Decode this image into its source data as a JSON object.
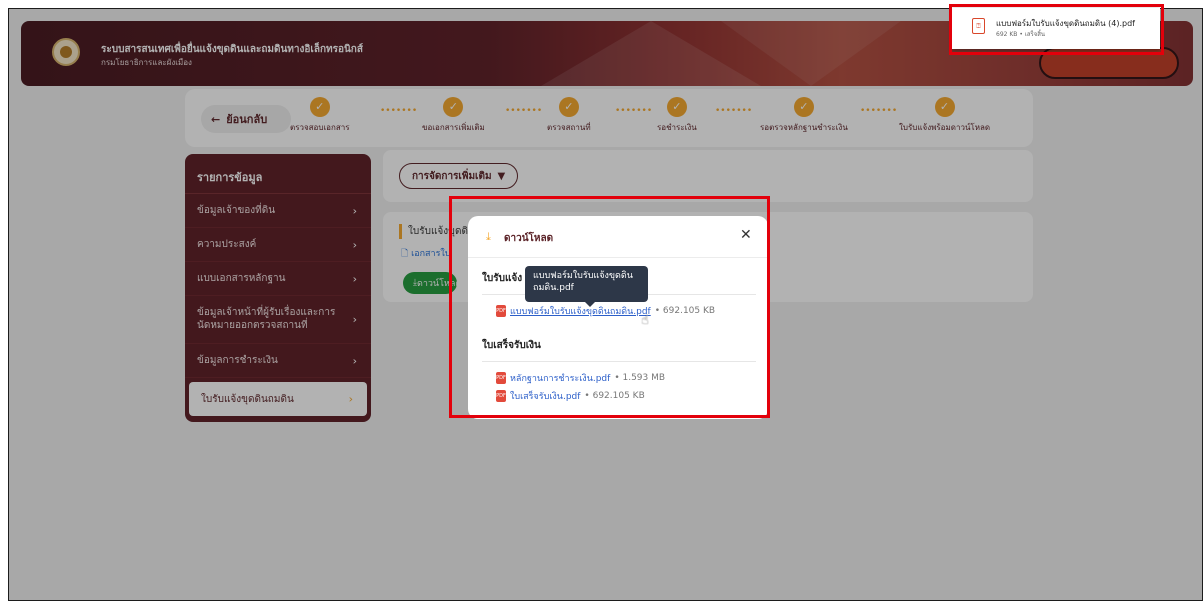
{
  "header": {
    "title": "ระบบสารสนเทศเพื่อยื่นแจ้งขุดดินและถมดินทางอิเล็กทรอนิกส์",
    "subtitle": "กรมโยธาธิการและผังเมือง"
  },
  "steps": {
    "back_label": "ย้อนกลับ",
    "items": [
      {
        "label": "ตรวจสอบเอกสาร"
      },
      {
        "label": "ขอเอกสารเพิ่มเติม"
      },
      {
        "label": "ตรวจสถานที่"
      },
      {
        "label": "รอชำระเงิน"
      },
      {
        "label": "รอตรวจหลักฐานชำระเงิน"
      },
      {
        "label": "ใบรับแจ้งพร้อมดาวน์โหลด"
      }
    ]
  },
  "sidebar": {
    "heading": "รายการข้อมูล",
    "items": [
      {
        "label": "ข้อมูลเจ้าของที่ดิน"
      },
      {
        "label": "ความประสงค์"
      },
      {
        "label": "แบบเอกสารหลักฐาน"
      },
      {
        "label": "ข้อมูลเจ้าหน้าที่ผู้รับเรื่องและการนัดหมายออกตรวจสถานที่"
      },
      {
        "label": "ข้อมูลการชำระเงิน"
      },
      {
        "label": "ใบรับแจ้งขุดดินถมดิน"
      }
    ]
  },
  "manage": {
    "label": "การจัดการเพิ่มเติม"
  },
  "doc_card": {
    "title": "ใบรับแจ้งขุดดิน",
    "link": "เอกสารใบ",
    "download": "ดาวน์โหลด"
  },
  "download_tray": {
    "filename": "แบบฟอร์มใบรับแจ้งขุดดินถมดิน (4).pdf",
    "meta": "692 KB • เสร็จสิ้น"
  },
  "modal": {
    "title": "ดาวน์โหลด",
    "section1": "ใบรับแจ้ง",
    "tooltip": "แบบฟอร์มใบรับแจ้งขุดดินถมดิน.pdf",
    "file1": {
      "name": "แบบฟอร์มใบรับแจ้งขุดดินถมดิน.pdf",
      "size": "• 692.105 KB"
    },
    "section2": "ใบเสร็จรับเงิน",
    "file2": {
      "name": "หลักฐานการชำระเงิน.pdf",
      "size": "• 1.593 MB"
    },
    "file3": {
      "name": "ใบเสร็จรับเงิน.pdf",
      "size": "• 692.105 KB"
    }
  },
  "colors": {
    "brand": "#5a1a22",
    "accent": "#f5a629",
    "highlight": "#e3000b"
  }
}
